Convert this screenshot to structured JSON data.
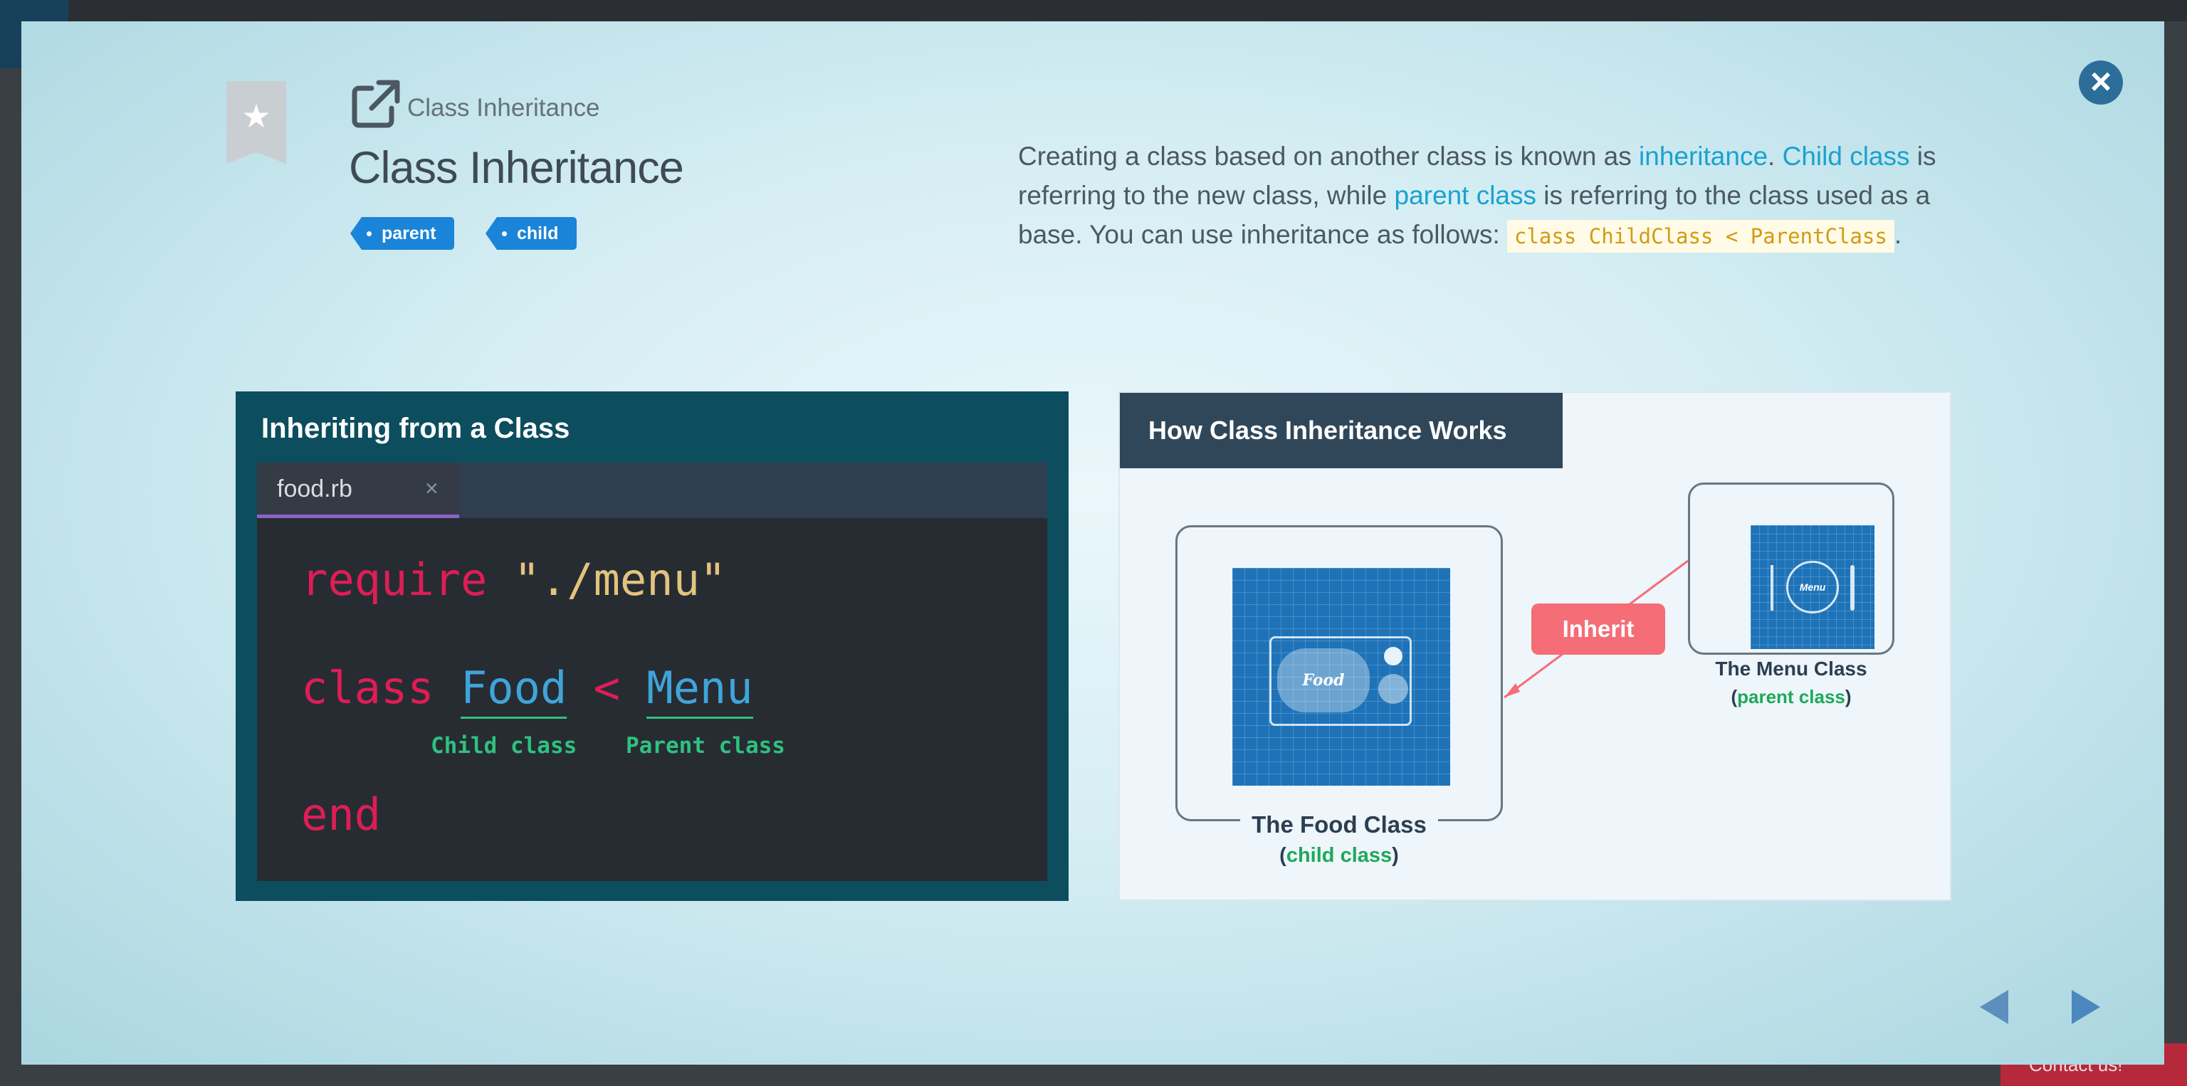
{
  "modal": {
    "breadcrumb": "Class Inheritance",
    "title": "Class Inheritance",
    "tags": [
      "parent",
      "child"
    ],
    "description": {
      "p1": "Creating a class based on another class is known as ",
      "link1": "inheritance",
      "p2": ". ",
      "link2": "Child class",
      "p3": " is referring to the new class, while ",
      "link3": "parent class",
      "p4": " is referring to the class used as a base. You can use inheritance as follows: ",
      "code": "class ChildClass < ParentClass",
      "p5": "."
    }
  },
  "left_panel": {
    "title": "Inheriting from a Class",
    "tab_filename": "food.rb",
    "tab_close": "×",
    "code": {
      "line1_kw": "require",
      "line1_str": "\"./menu\"",
      "line2_kw": "class",
      "line2_child": "Food",
      "line2_op": "<",
      "line2_parent": "Menu",
      "line3_kw": "end"
    },
    "child_note": "Child class",
    "parent_note": "Parent class"
  },
  "right_panel": {
    "title": "How Class Inheritance Works",
    "inherit_label": "Inherit",
    "food_image_text": "Food",
    "menu_image_text": "Menu",
    "food_label": "The Food Class",
    "food_sub": "child class",
    "menu_label": "The Menu Class",
    "menu_sub": "parent class"
  },
  "background": {
    "contact": "Contact us!"
  },
  "colors": {
    "accent": "#1aa2cf",
    "tag_bg": "#1a84d9",
    "keyword": "#df1d55",
    "string": "#e3c37d",
    "class_name": "#3fa5d9",
    "note_green": "#2ec27e",
    "inherit_red": "#f56d76"
  },
  "icons": [
    "close-icon",
    "bookmark-star-icon",
    "external-link-icon",
    "prev-arrow-icon",
    "next-arrow-icon"
  ]
}
